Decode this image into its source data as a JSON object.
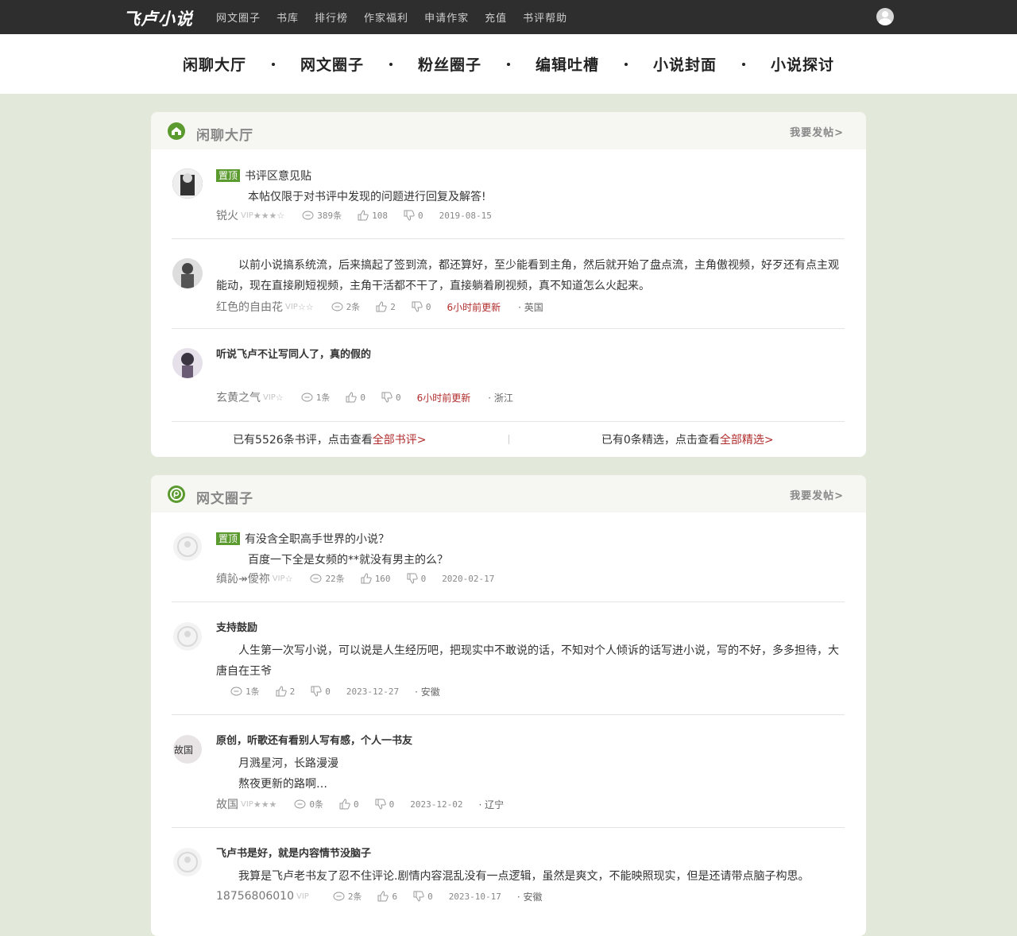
{
  "topbar": {
    "logo": "飞卢小说",
    "nav": [
      "网文圈子",
      "书库",
      "排行榜",
      "作家福利",
      "申请作家",
      "充值",
      "书评帮助"
    ]
  },
  "subnav": [
    "闲聊大厅",
    "网文圈子",
    "粉丝圈子",
    "编辑吐槽",
    "小说封面",
    "小说探讨"
  ],
  "panel1": {
    "title": "闲聊大厅",
    "post": "我要发帖>",
    "items": [
      {
        "badge": "置顶",
        "title": "书评区意见贴",
        "body": "本帖仅限于对书评中发现的问题进行回复及解答!",
        "author": "锐火",
        "vip": "VIP",
        "stars": "★★★☆",
        "comments": "389条",
        "likes": "108",
        "dislikes": "0",
        "date": "2019-08-15"
      },
      {
        "body": "以前小说搞系统流，后来搞起了签到流，都还算好，至少能看到主角，然后就开始了盘点流，主角傲视频，好歹还有点主观能动，现在直接刷短视频，主角干活都不干了，直接躺着刷视频，真不知道怎么火起来。",
        "author": "红色的自由花",
        "vip": "VIP",
        "stars": "☆☆",
        "comments": "2条",
        "likes": "2",
        "dislikes": "0",
        "updated": "6小时前更新",
        "loc": "· 英国"
      },
      {
        "title": "听说飞卢不让写同人了，真的假的",
        "author": "玄黄之气",
        "vip": "VIP",
        "stars": "☆",
        "comments": "1条",
        "likes": "0",
        "dislikes": "0",
        "updated": "6小时前更新",
        "loc": "· 浙江"
      }
    ],
    "footer": {
      "left_text": "已有5526条书评，点击查看",
      "left_link": "全部书评>",
      "right_text": "已有0条精选，点击查看",
      "right_link": "全部精选>"
    }
  },
  "panel2": {
    "title": "网文圈子",
    "post": "我要发帖>",
    "items": [
      {
        "badge": "置顶",
        "title": "有没含全职高手世界的小说？",
        "body": "百度一下全是女频的**就没有男主的么？",
        "author": "缜訫↠僾祢",
        "vip": "VIP",
        "stars": "☆",
        "comments": "22条",
        "likes": "160",
        "dislikes": "0",
        "date": "2020-02-17"
      },
      {
        "title": "支持鼓励",
        "body": "人生第一次写小说，可以说是人生经历吧，把现实中不敢说的话，不知对个人倾诉的话写进小说，写的不好，多多担待，大唐自在王爷",
        "comments": "1条",
        "likes": "2",
        "dislikes": "0",
        "date": "2023-12-27",
        "loc": "· 安徽"
      },
      {
        "title": "原创，听歌还有看别人写有感，个人一书友",
        "line1": "月溅星河，长路漫漫",
        "line2": "熬夜更新的路啊…",
        "author": "故国",
        "vip": "VIP",
        "stars": "★★★",
        "comments": "0条",
        "likes": "0",
        "dislikes": "0",
        "date": "2023-12-02",
        "loc": "· 辽宁"
      },
      {
        "title": "飞卢书是好，就是内容情节没脑子",
        "body": "我算是飞卢老书友了忍不住评论.剧情内容混乱没有一点逻辑，虽然是爽文，不能映照现实，但是还请带点脑子构思。",
        "author": "18756806010",
        "vip": "VIP",
        "comments": "2条",
        "likes": "6",
        "dislikes": "0",
        "date": "2023-10-17",
        "loc": "· 安徽"
      }
    ]
  },
  "avatar_text": "故国",
  "colors": {
    "brand_green": "#5b9a2e",
    "accent_red": "#b12c2c",
    "bg": "#e2e8da",
    "topbar": "#2e2e2e"
  }
}
